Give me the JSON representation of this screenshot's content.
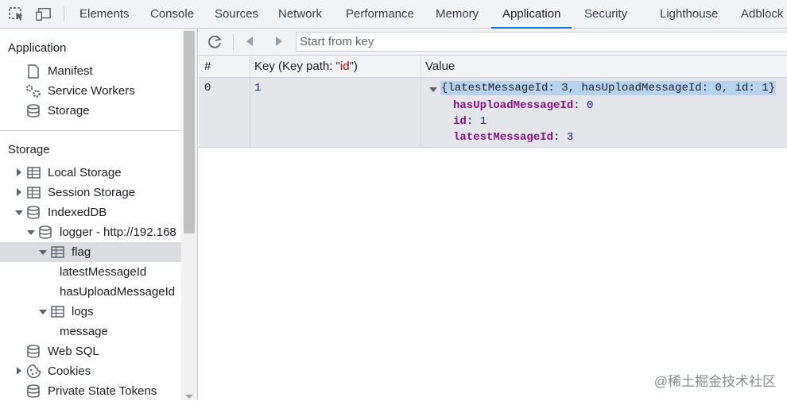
{
  "tabs": [
    "Elements",
    "Console",
    "Sources",
    "Network",
    "Performance",
    "Memory",
    "Application",
    "Security",
    "Lighthouse",
    "Adblock"
  ],
  "active_tab": "Application",
  "sidebar": {
    "application_title": "Application",
    "application_items": [
      {
        "label": "Manifest",
        "icon": "document-icon"
      },
      {
        "label": "Service Workers",
        "icon": "gears-icon"
      },
      {
        "label": "Storage",
        "icon": "database-icon"
      }
    ],
    "storage_title": "Storage",
    "storage_items": [
      {
        "label": "Local Storage",
        "icon": "table-icon"
      },
      {
        "label": "Session Storage",
        "icon": "table-icon"
      },
      {
        "label": "IndexedDB",
        "icon": "database-icon"
      },
      {
        "label": "logger - http://192.168",
        "icon": "database-icon"
      },
      {
        "label": "flag",
        "icon": "table-icon",
        "selected": true
      },
      {
        "label": "latestMessageId"
      },
      {
        "label": "hasUploadMessageId"
      },
      {
        "label": "logs",
        "icon": "table-icon"
      },
      {
        "label": "message"
      },
      {
        "label": "Web SQL",
        "icon": "database-icon"
      },
      {
        "label": "Cookies",
        "icon": "cookie-icon"
      },
      {
        "label": "Private State Tokens",
        "icon": "database-icon"
      }
    ]
  },
  "toolbar": {
    "key_placeholder": "Start from key"
  },
  "table": {
    "columns": [
      "#",
      "Key (Key path: \"id\")",
      "Value"
    ],
    "key_path_prefix": "Key (Key path: \"",
    "key_path_name": "id",
    "key_path_suffix": "\")",
    "rows": [
      {
        "index": "0",
        "key": "1",
        "value_summary": "{latestMessageId: 3, hasUploadMessageId: 0, id: 1}",
        "properties": [
          {
            "name": "hasUploadMessageId",
            "value": "0"
          },
          {
            "name": "id",
            "value": "1"
          },
          {
            "name": "latestMessageId",
            "value": "3"
          }
        ]
      }
    ]
  },
  "watermark": "@稀土掘金技术社区",
  "colors": {
    "accent": "#1a73e8",
    "selection": "#b7d3f0",
    "property": "#881280",
    "number": "#1a1aa6"
  }
}
